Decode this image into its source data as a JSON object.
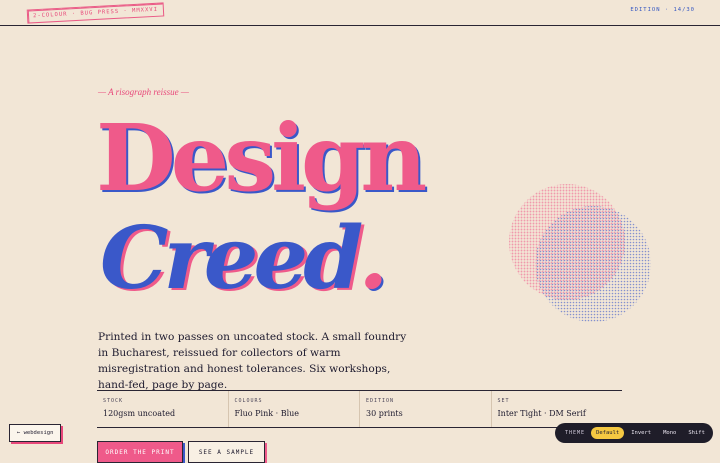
{
  "header": {
    "stamp": "2-COLOUR · BUG PRESS · MMXXVI",
    "edition": "EDITION · 14/30"
  },
  "hero": {
    "kicker": "— A risograph reissue —",
    "line1": "Design",
    "line2": "Creed",
    "line2_dot": "."
  },
  "lead": "Printed in two passes on uncoated stock. A small foundry in Bucharest, reissued for collectors of warm misregistration and honest tolerances. Six workshops, hand-fed, page by page.",
  "specs": [
    {
      "label": "STOCK",
      "value": "120gsm uncoated"
    },
    {
      "label": "COLOURS",
      "value": "Fluo Pink · Blue"
    },
    {
      "label": "EDITION",
      "value": "30 prints"
    },
    {
      "label": "SET",
      "value": "Inter Tight · DM Serif"
    }
  ],
  "buttons": {
    "primary": "ORDER THE PRINT",
    "secondary": "SEE A SAMPLE"
  },
  "badge": {
    "label": "← webdesign"
  },
  "theme": {
    "icon": "half-circle-icon",
    "label": "THEME",
    "options": [
      "Default",
      "Invert",
      "Mono",
      "Shift"
    ],
    "active": "Default"
  },
  "colors": {
    "paper": "#f2e6d6",
    "fluo_pink": "#ef5a8a",
    "blue": "#3a58c9",
    "ink": "#1d1a2e",
    "theme_active": "#f5c842"
  }
}
